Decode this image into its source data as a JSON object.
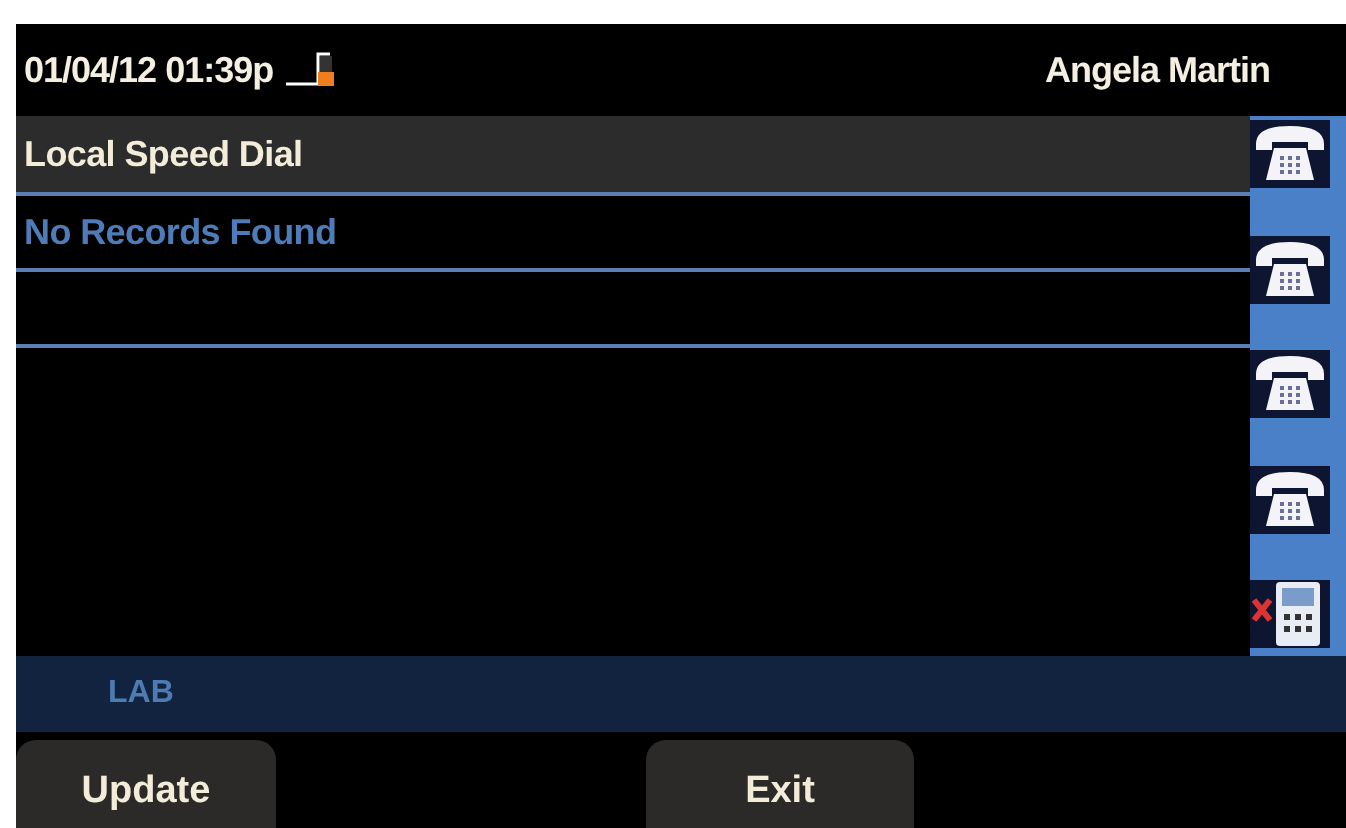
{
  "header": {
    "datetime": "01/04/12 01:39p",
    "user": "Angela Martin"
  },
  "list": {
    "title": "Local Speed Dial",
    "message": "No Records Found"
  },
  "line_keys": [
    {
      "kind": "phone"
    },
    {
      "kind": "phone"
    },
    {
      "kind": "phone"
    },
    {
      "kind": "phone"
    },
    {
      "kind": "blocked-phone"
    }
  ],
  "status_bar": {
    "label": "LAB"
  },
  "softkeys": [
    "Update",
    "Exit"
  ]
}
